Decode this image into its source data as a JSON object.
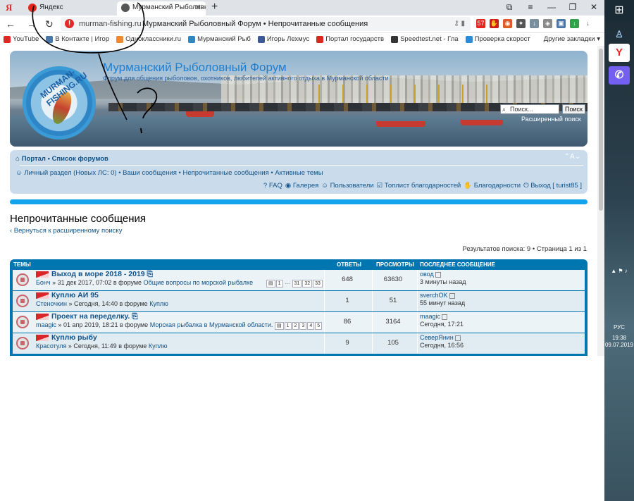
{
  "browser": {
    "logo": "Я",
    "tabs": [
      {
        "label": "Яндекс",
        "icon_color": "#e52620"
      },
      {
        "label": "Мурманский Рыболовн",
        "icon_color": "#555555"
      }
    ],
    "new_tab": "+",
    "window_controls": {
      "pin": "⧉",
      "minimize": "—",
      "restore": "❐",
      "close": "✕"
    },
    "url_host": "murman-fishing.ru",
    "url_title": "Мурманский Рыболовный Форум • Непрочитанные сообщения",
    "url_warning": "!",
    "nav": {
      "back": "←",
      "forward": "→",
      "reload": "↻"
    },
    "bookmarks": [
      {
        "label": "YouTube",
        "color": "#e52620"
      },
      {
        "label": "В Контакте | Игор",
        "color": "#4a76a8"
      },
      {
        "label": "Одноклассники.ru",
        "color": "#f0872b"
      },
      {
        "label": "Мурманский Рыб",
        "color": "#2f86c6"
      },
      {
        "label": "Игорь Лехмус",
        "color": "#3b5998"
      },
      {
        "label": "Портал государств",
        "color": "#d52b1e"
      },
      {
        "label": "Speedtest.net - Гла",
        "color": "#333333"
      },
      {
        "label": "Проверка скорост",
        "color": "#2a8bd8"
      }
    ],
    "other_bookmarks": "Другие закладки ▾"
  },
  "banner": {
    "title": "Мурманский Рыболовный Форум",
    "description": "Форум для общения рыболовов, охотников, любителей активного отдыха в Мурманской области",
    "logo_text": "MURMAN-FISHING.RU",
    "search_placeholder": "Поиск...",
    "search_button": "Поиск",
    "advanced_search": "Расширенный поиск"
  },
  "navbar": {
    "crumbs": "Портал • Список форумов",
    "personal": "Личный раздел (Новых ЛС: 0)",
    "links": "• Ваши сообщения • Непрочитанные сообщения • Активные темы",
    "quick_links": [
      "FAQ",
      "Галерея",
      "Пользователи",
      "Топлист благодарностей",
      "Благодарности",
      "Выход [ turist85 ]"
    ]
  },
  "page": {
    "heading": "Непрочитанные сообщения",
    "back_link": "‹ Вернуться к расширенному поиску",
    "pagination": "Результатов поиска: 9 • Страница 1 из 1"
  },
  "table": {
    "headers": {
      "topics": "ТЕМЫ",
      "replies": "ОТВЕТЫ",
      "views": "ПРОСМОТРЫ",
      "last": "ПОСЛЕДНЕЕ СООБЩЕНИЕ"
    },
    "rows": [
      {
        "title": "Выход в море 2018 - 2019",
        "author": "Бонч",
        "date": "31 дек 2017, 07:02",
        "forum_prefix": "в форуме",
        "forum": "Общие вопросы по морской рыбалке",
        "pages": [
          "1",
          "…",
          "31",
          "32",
          "33"
        ],
        "replies": "648",
        "views": "63630",
        "last_author": "овод",
        "last_time": "3 минуты назад"
      },
      {
        "title": "Куплю АИ 95",
        "author": "Стеночкин",
        "date": "Сегодня, 14:40",
        "forum_prefix": "в форуме",
        "forum": "Куплю",
        "pages": [],
        "replies": "1",
        "views": "51",
        "last_author": "sverchOK",
        "last_time": "55 минут назад"
      },
      {
        "title": "Проект на переделку.",
        "author": "maagic",
        "date": "01 апр 2019, 18:21",
        "forum_prefix": "в форуме",
        "forum": "Морская рыбалка в Мурманской области.",
        "pages": [
          "1",
          "2",
          "3",
          "4",
          "5"
        ],
        "replies": "86",
        "views": "3164",
        "last_author": "maagic",
        "last_time": "Сегодня, 17:21"
      },
      {
        "title": "Куплю рыбу",
        "author": "Красотуля",
        "date": "Сегодня, 11:49",
        "forum_prefix": "в форуме",
        "forum": "Куплю",
        "pages": [],
        "replies": "9",
        "views": "105",
        "last_author": "СеверЯнин",
        "last_time": "Сегодня, 16:56"
      }
    ]
  },
  "taskbar": {
    "start": "⊞",
    "apps": [
      {
        "name": "yandex",
        "label": "Y",
        "bg": "#ffffff",
        "color": "#e52620"
      },
      {
        "name": "viber",
        "label": "✆",
        "bg": "#7360f2",
        "color": "#ffffff"
      }
    ],
    "tray": "▲  ⚑  ♪",
    "lang": "РУС",
    "time": "19:38",
    "date": "09.07.2019"
  },
  "colors": {
    "accent": "#0076b1",
    "link": "#105289",
    "navbar": "#cadceb",
    "bluebar": "#12a3eb"
  }
}
